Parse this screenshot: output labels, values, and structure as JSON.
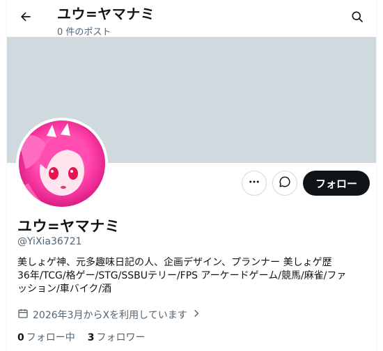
{
  "header": {
    "title": "ユウ=ヤマナミ",
    "post_count": "0 件のポスト"
  },
  "profile": {
    "display_name": "ユウ=ヤマナミ",
    "handle": "@YiXia36721",
    "bio_line1": "美しょゲ神、元多趣味日記の人、企画デザイン、プランナー 美しょゲ歴",
    "bio_line2": "36年/TCG/格ゲー/STG/SSBUテリー/FPS アーケードゲーム/競馬/麻雀/ファ",
    "bio_line3": "ッション/車バイク/酒",
    "joined": "2026年3月からXを利用しています"
  },
  "actions": {
    "follow_label": "フォロー",
    "more_icon": "more-horizontal-icon",
    "message_icon": "message-icon"
  },
  "stats": {
    "following_count": "0",
    "following_label": "フォロー中",
    "followers_count": "3",
    "followers_label": "フォロワー"
  },
  "colors": {
    "banner": "#cfd9de",
    "text": "#0f1419",
    "secondary_text": "#536471",
    "follow_button": "#0f1419",
    "avatar_main": "#ff3fa8"
  }
}
